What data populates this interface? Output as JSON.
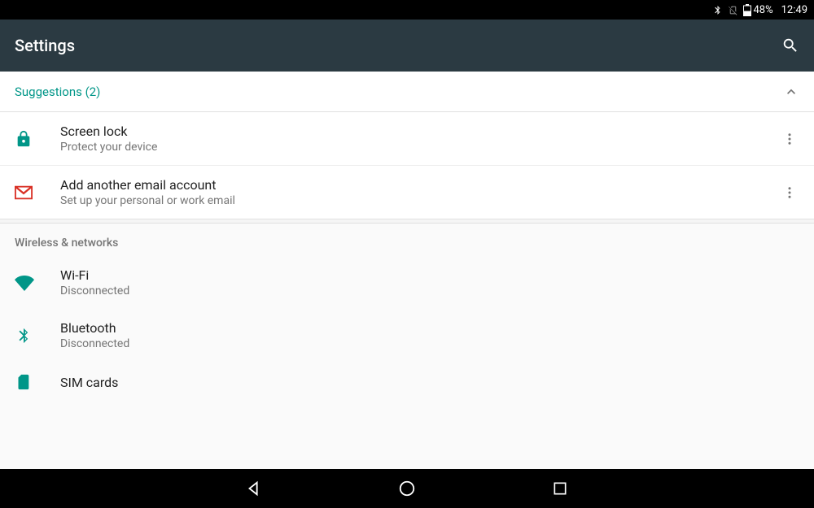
{
  "statusbar": {
    "battery_percent": "48%",
    "time": "12:49"
  },
  "appbar": {
    "title": "Settings"
  },
  "suggestions": {
    "header": "Suggestions (2)",
    "items": [
      {
        "title": "Screen lock",
        "subtitle": "Protect your device",
        "icon": "lock-icon"
      },
      {
        "title": "Add another email account",
        "subtitle": "Set up your personal or work email",
        "icon": "gmail-icon"
      }
    ]
  },
  "sections": {
    "wireless_label": "Wireless & networks",
    "items": [
      {
        "title": "Wi-Fi",
        "subtitle": "Disconnected",
        "icon": "wifi-icon"
      },
      {
        "title": "Bluetooth",
        "subtitle": "Disconnected",
        "icon": "bluetooth-icon"
      },
      {
        "title": "SIM cards",
        "subtitle": "",
        "icon": "sim-icon"
      }
    ]
  },
  "colors": {
    "accent": "#009688",
    "gmail_red": "#d93025"
  }
}
